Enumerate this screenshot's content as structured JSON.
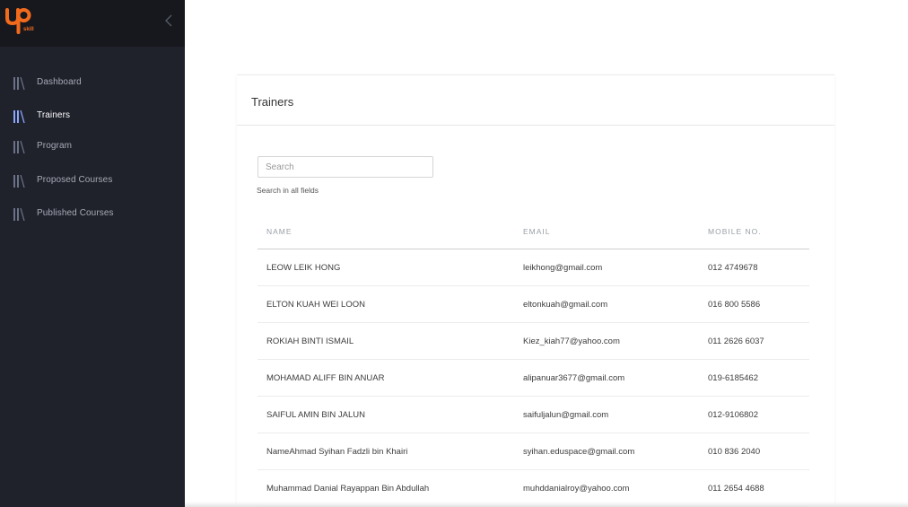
{
  "sidebar": {
    "logo_text": "skill",
    "items": [
      {
        "label": "Dashboard",
        "active": false
      },
      {
        "label": "Trainers",
        "active": true
      },
      {
        "label": "Program",
        "active": false
      },
      {
        "label": "Proposed Courses",
        "active": false
      },
      {
        "label": "Published Courses",
        "active": false
      }
    ]
  },
  "main": {
    "title": "Trainers",
    "search": {
      "placeholder": "Search",
      "value": "",
      "hint": "Search in all fields"
    },
    "table": {
      "headers": {
        "name": "NAME",
        "email": "EMAIL",
        "mobile": "MOBILE NO."
      },
      "rows": [
        {
          "name": "LEOW LEIK HONG",
          "email": "leikhong@gmail.com",
          "mobile": "012 4749678"
        },
        {
          "name": "ELTON KUAH WEI LOON",
          "email": "eltonkuah@gmail.com",
          "mobile": "016 800 5586"
        },
        {
          "name": "ROKIAH BINTI ISMAIL",
          "email": "Kiez_kiah77@yahoo.com",
          "mobile": "011 2626 6037"
        },
        {
          "name": "MOHAMAD ALIFF BIN ANUAR",
          "email": "alipanuar3677@gmail.com",
          "mobile": "019-6185462"
        },
        {
          "name": "SAIFUL AMIN BIN JALUN",
          "email": "saifuljalun@gmail.com",
          "mobile": "012-9106802"
        },
        {
          "name": "NameAhmad Syihan Fadzli bin Khairi",
          "email": "syihan.eduspace@gmail.com",
          "mobile": "010 836 2040"
        },
        {
          "name": "Muhammad Danial Rayappan Bin Abdullah",
          "email": "muhddanialroy@yahoo.com",
          "mobile": "011 2654 4688"
        }
      ]
    }
  },
  "colors": {
    "sidebar_bg": "#1f212b",
    "sidebar_top_bg": "#17181e",
    "accent": "#f26b1d",
    "nav_icon": "#6b7186",
    "nav_icon_active": "#8aa6ff"
  }
}
